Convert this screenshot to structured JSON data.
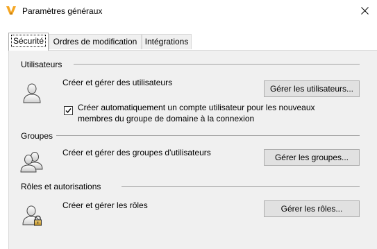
{
  "window": {
    "title": "Paramètres généraux",
    "app_icon": "autodesk-vault-logo",
    "brand_color": "#f5a623"
  },
  "tabs": [
    {
      "label": "Sécurité",
      "active": true
    },
    {
      "label": "Ordres de modification",
      "active": false
    },
    {
      "label": "Intégrations",
      "active": false
    }
  ],
  "sections": {
    "users": {
      "title": "Utilisateurs",
      "description": "Créer et gérer des utilisateurs",
      "button": "Gérer les utilisateurs...",
      "icon": "user-icon",
      "checkbox": {
        "checked": true,
        "label_line1": "Créer automatiquement un compte utilisateur pour les nouveaux",
        "label_line2": "membres du groupe de domaine à la connexion"
      }
    },
    "groups": {
      "title": "Groupes",
      "description": "Créer et gérer des groupes d'utilisateurs",
      "button": "Gérer les groupes...",
      "icon": "group-icon"
    },
    "roles": {
      "title": "Rôles et autorisations",
      "description": "Créer et gérer les rôles",
      "button": "Gérer les rôles...",
      "icon": "role-lock-icon"
    }
  }
}
